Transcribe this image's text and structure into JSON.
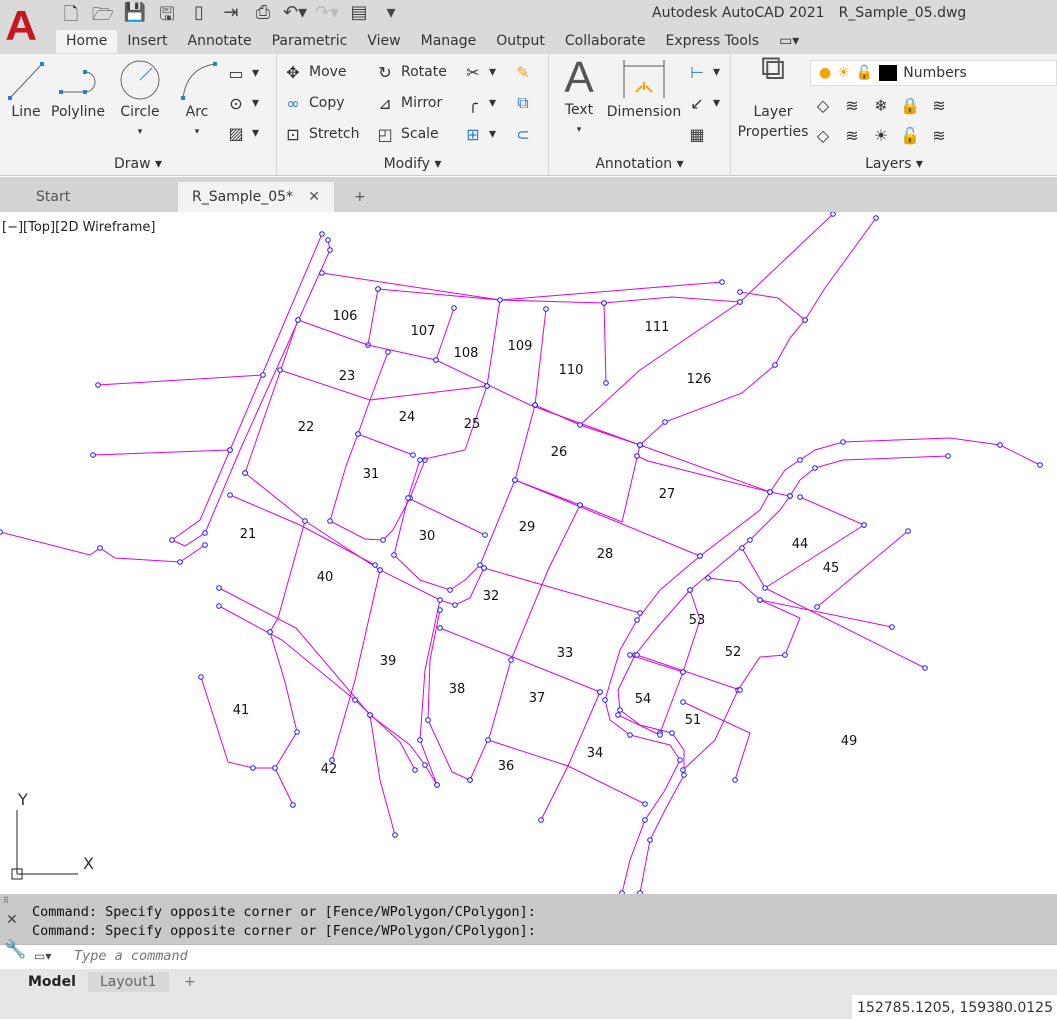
{
  "app": {
    "title": "Autodesk AutoCAD 2021",
    "document": "R_Sample_05.dwg",
    "logo": "A"
  },
  "qat": [
    "new-icon",
    "open-icon",
    "save-icon",
    "save-as-icon",
    "open-web-icon",
    "share-icon",
    "plot-icon",
    "undo-icon",
    "redo-icon",
    "workspace-icon",
    "customize-icon"
  ],
  "tabs": [
    "Home",
    "Insert",
    "Annotate",
    "Parametric",
    "View",
    "Manage",
    "Output",
    "Collaborate",
    "Express Tools"
  ],
  "active_tab": "Home",
  "ribbon": {
    "draw": {
      "title": "Draw",
      "line": "Line",
      "polyline": "Polyline",
      "circle": "Circle",
      "arc": "Arc"
    },
    "modify": {
      "title": "Modify",
      "move": "Move",
      "rotate": "Rotate",
      "copy": "Copy",
      "mirror": "Mirror",
      "stretch": "Stretch",
      "scale": "Scale"
    },
    "annotation": {
      "title": "Annotation",
      "text": "Text",
      "dimension": "Dimension"
    },
    "layers": {
      "title": "Layers",
      "layer_properties_1": "Layer",
      "layer_properties_2": "Properties",
      "current_layer": "Numbers",
      "layer_color": "#000000"
    }
  },
  "doc_tabs": {
    "start": "Start",
    "current": "R_Sample_05*",
    "add": "+"
  },
  "viewport": {
    "label": "[−][Top][2D Wireframe]",
    "line_color": "#e000e0",
    "vertex_color": "#1a1aff",
    "ucs_x": "X",
    "ucs_y": "Y",
    "parcels": [
      "106",
      "107",
      "108",
      "109",
      "110",
      "111",
      "126",
      "23",
      "24",
      "25",
      "22",
      "26",
      "31",
      "27",
      "21",
      "30",
      "29",
      "28",
      "44",
      "45",
      "40",
      "32",
      "53",
      "52",
      "39",
      "33",
      "38",
      "37",
      "54",
      "51",
      "41",
      "49",
      "42",
      "36",
      "34"
    ]
  },
  "command": {
    "history": [
      "Command: Specify opposite corner or [Fence/WPolygon/CPolygon]:",
      "Command: Specify opposite corner or [Fence/WPolygon/CPolygon]:"
    ],
    "placeholder": "Type a command"
  },
  "layouts": [
    "Model",
    "Layout1",
    "+"
  ],
  "status": {
    "coordinates": "152785.1205, 159380.0125"
  }
}
